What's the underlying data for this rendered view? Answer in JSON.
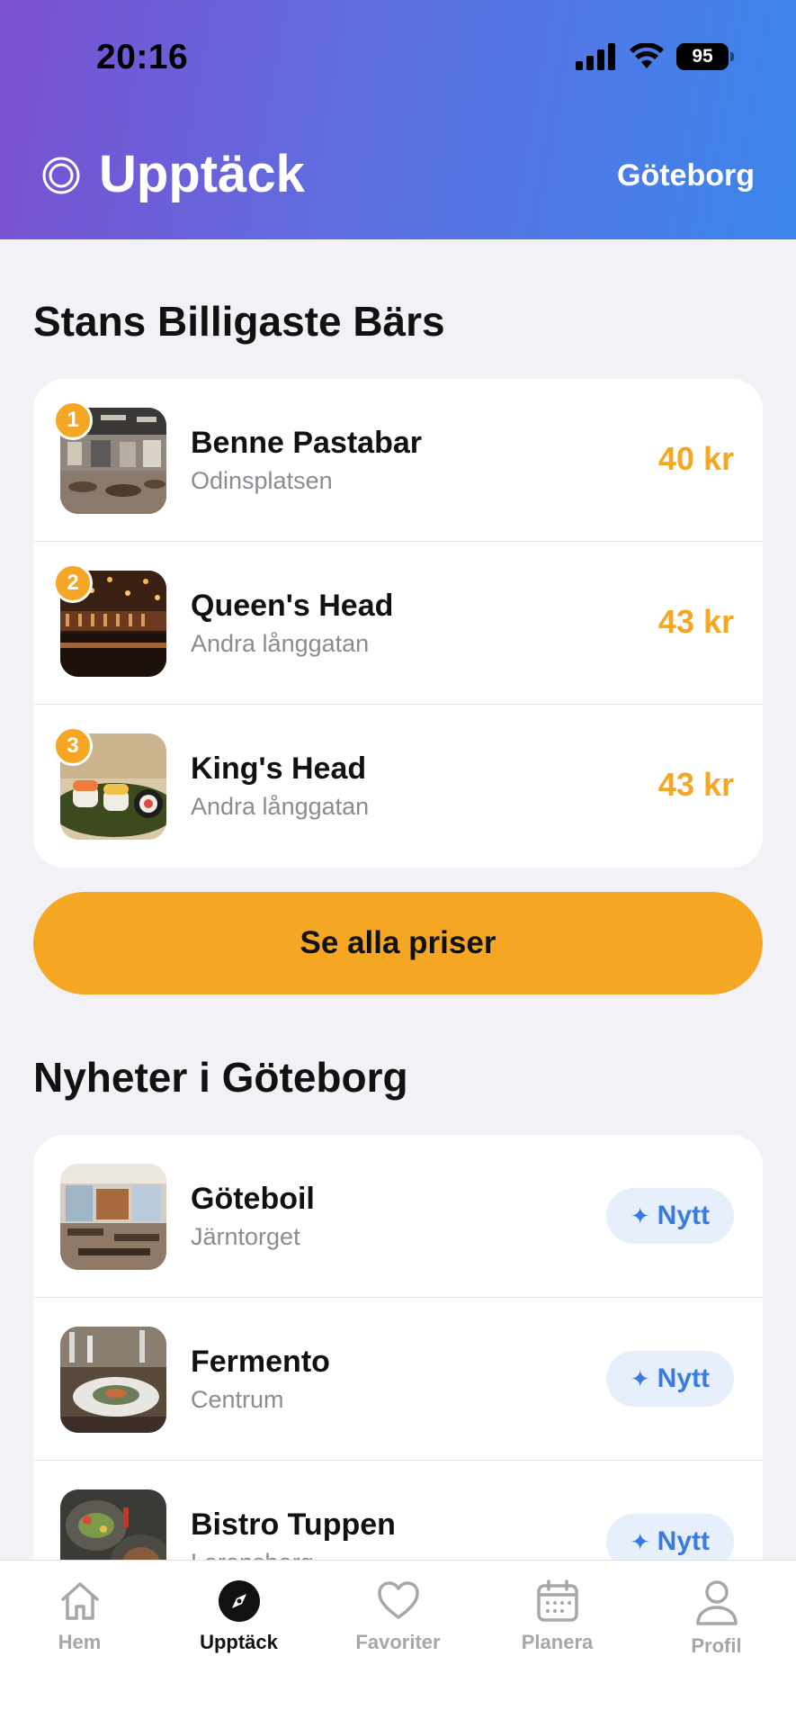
{
  "status_bar": {
    "time": "20:16",
    "battery": "95"
  },
  "header": {
    "title": "Upptäck",
    "city": "Göteborg"
  },
  "cheapest": {
    "title": "Stans Billigaste Bärs",
    "items": [
      {
        "rank": "1",
        "name": "Benne Pastabar",
        "location": "Odinsplatsen",
        "price": "40 kr"
      },
      {
        "rank": "2",
        "name": "Queen's Head",
        "location": "Andra långgatan",
        "price": "43 kr"
      },
      {
        "rank": "3",
        "name": "King's Head",
        "location": "Andra långgatan",
        "price": "43 kr"
      }
    ],
    "cta_label": "Se alla priser"
  },
  "news": {
    "title": "Nyheter i Göteborg",
    "items": [
      {
        "name": "Göteboil",
        "location": "Järntorget",
        "badge": "Nytt"
      },
      {
        "name": "Fermento",
        "location": "Centrum",
        "badge": "Nytt"
      },
      {
        "name": "Bistro Tuppen",
        "location": "Lorensberg",
        "badge": "Nytt"
      }
    ]
  },
  "tabbar": {
    "tabs": [
      {
        "label": "Hem",
        "icon": "home-icon"
      },
      {
        "label": "Upptäck",
        "icon": "compass-icon",
        "active": true
      },
      {
        "label": "Favoriter",
        "icon": "heart-icon"
      },
      {
        "label": "Planera",
        "icon": "calendar-icon"
      },
      {
        "label": "Profil",
        "icon": "person-icon"
      }
    ]
  },
  "colors": {
    "accent": "#f5a623",
    "badge_blue": "#3a7be0",
    "header_gradient_start": "#7b4fd1",
    "header_gradient_end": "#3c86ec"
  }
}
